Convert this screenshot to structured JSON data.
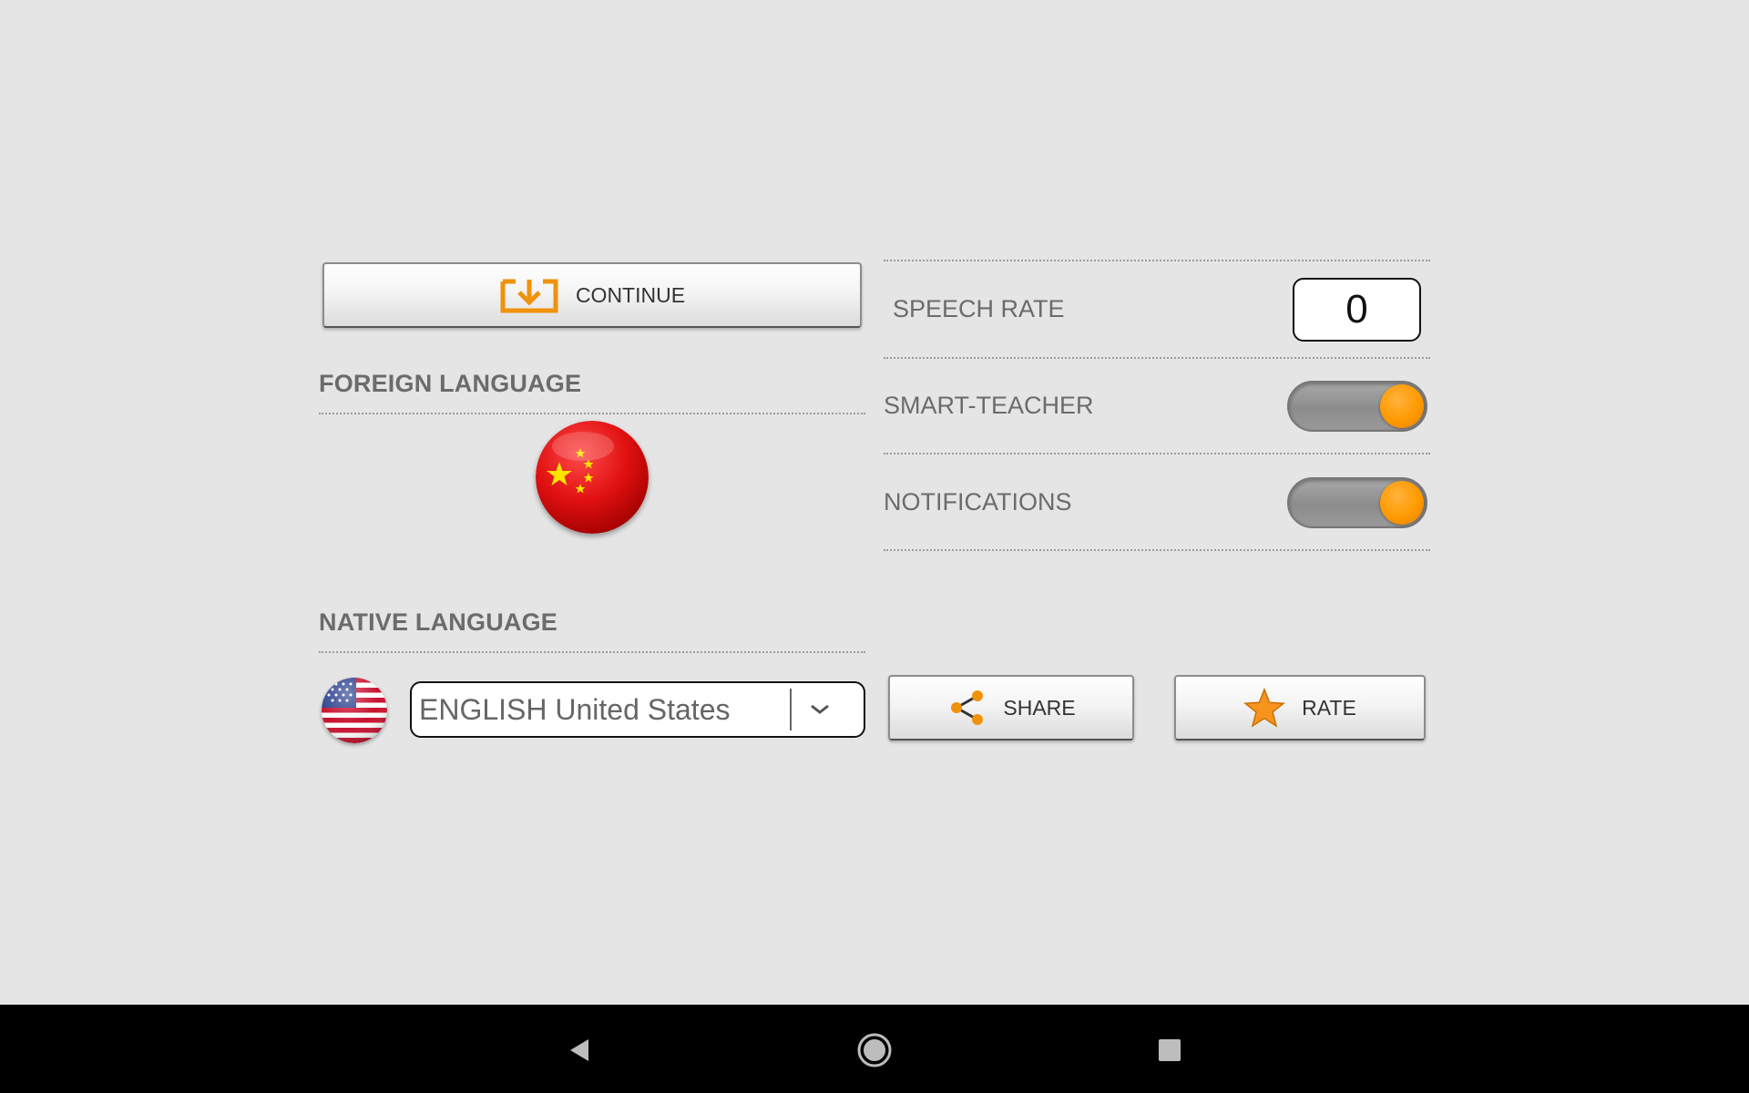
{
  "settings": {
    "continue_label": "CONTINUE",
    "foreign_language_title": "FOREIGN LANGUAGE",
    "native_language_title": "NATIVE LANGUAGE",
    "foreign_language_flag": "china-flag-icon",
    "native_language_flag": "usa-flag-icon",
    "native_language_value": "ENGLISH United States",
    "speech_rate_label": "SPEECH RATE",
    "speech_rate_value": "0",
    "smart_teacher_label": "SMART-TEACHER",
    "smart_teacher_on": true,
    "notifications_label": "NOTIFICATIONS",
    "notifications_on": true,
    "share_label": "SHARE",
    "rate_label": "RATE"
  },
  "colors": {
    "accent": "#ff9a00",
    "background": "#e5e5e5",
    "navbar": "#000000"
  },
  "navbar": {
    "back_icon": "back-triangle-icon",
    "home_icon": "home-circle-icon",
    "recents_icon": "recents-square-icon"
  }
}
